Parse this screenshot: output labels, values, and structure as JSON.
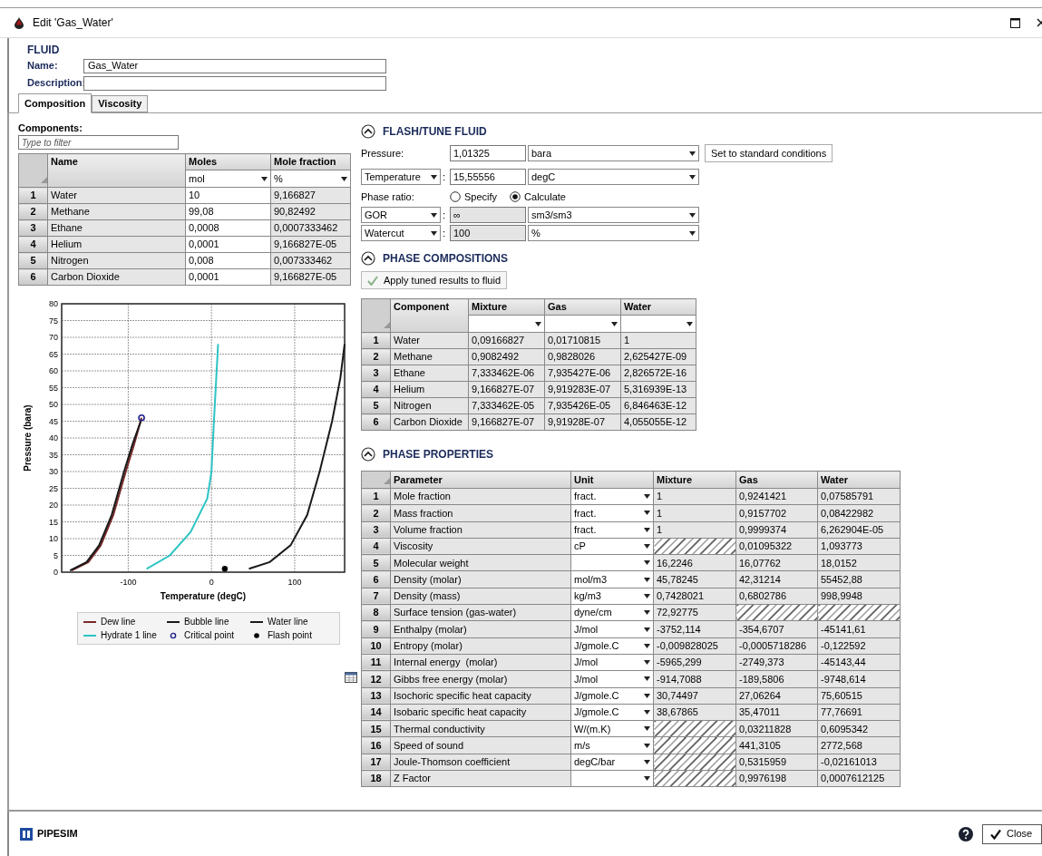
{
  "window": {
    "title": "Edit 'Gas_Water'"
  },
  "fluid": {
    "heading": "FLUID",
    "name_label": "Name:",
    "name_value": "Gas_Water",
    "description_label": "Description:"
  },
  "tabs": [
    {
      "label": "Composition",
      "selected": true
    },
    {
      "label": "Viscosity",
      "selected": false
    }
  ],
  "components": {
    "label": "Components:",
    "filter_placeholder": "Type to filter",
    "columns": [
      {
        "label": "Name"
      },
      {
        "label": "Moles",
        "unit": "mol"
      },
      {
        "label": "Mole fraction",
        "unit": "%"
      }
    ],
    "rows": [
      {
        "index": "1",
        "name": "Water",
        "moles": "10",
        "mole_fraction": "9,166827"
      },
      {
        "index": "2",
        "name": "Methane",
        "moles": "99,08",
        "mole_fraction": "90,82492"
      },
      {
        "index": "3",
        "name": "Ethane",
        "moles": "0,0008",
        "mole_fraction": "0,0007333462"
      },
      {
        "index": "4",
        "name": "Helium",
        "moles": "0,0001",
        "mole_fraction": "9,166827E-05"
      },
      {
        "index": "5",
        "name": "Nitrogen",
        "moles": "0,008",
        "mole_fraction": "0,007333462"
      },
      {
        "index": "6",
        "name": "Carbon Dioxide",
        "moles": "0,0001",
        "mole_fraction": "9,166827E-05"
      }
    ]
  },
  "phase_envelope": {
    "chart_data": {
      "type": "line",
      "xlabel": "Temperature (degC)",
      "ylabel": "Pressure (bara)",
      "xlim": [
        -180,
        160
      ],
      "ylim": [
        0,
        80
      ],
      "xticks": [
        -100,
        0,
        100
      ],
      "yticks": [
        0,
        5,
        10,
        15,
        20,
        25,
        30,
        35,
        40,
        45,
        50,
        55,
        60,
        65,
        70,
        75,
        80
      ],
      "grid": true,
      "series": [
        {
          "name": "Dew line",
          "color": "#7a2a2a",
          "x": [
            -168,
            -148,
            -133,
            -118,
            -103,
            -93,
            -84
          ],
          "values": [
            0.5,
            3,
            8,
            17,
            30,
            38,
            46
          ]
        },
        {
          "name": "Bubble line",
          "color": "#1a1a1a",
          "x": [
            -170,
            -150,
            -135,
            -120,
            -105,
            -95,
            -85
          ],
          "values": [
            0.5,
            3,
            8,
            17,
            30,
            38,
            45
          ]
        },
        {
          "name": "Water line",
          "color": "#1a1a1a",
          "x": [
            45,
            70,
            95,
            115,
            130,
            145,
            155,
            160
          ],
          "values": [
            1,
            3,
            8,
            17,
            30,
            45,
            58,
            68
          ]
        },
        {
          "name": "Hydrate 1 line",
          "color": "#2ec4c4",
          "x": [
            -78,
            -50,
            -25,
            -5,
            0,
            3,
            8
          ],
          "values": [
            1,
            5,
            12,
            22,
            30,
            45,
            68
          ]
        },
        {
          "name": "Critical point",
          "marker": "open_circle",
          "color": "#1e1e8c",
          "x": [
            -84
          ],
          "values": [
            46
          ]
        },
        {
          "name": "Flash point",
          "marker": "filled_circle",
          "color": "#000000",
          "x": [
            16
          ],
          "values": [
            1
          ]
        }
      ]
    }
  },
  "flash": {
    "heading": "FLASH/TUNE FLUID",
    "expanded": true,
    "pressure": {
      "label": "Pressure:",
      "value": "1,01325",
      "unit": "bara",
      "button": "Set to standard conditions"
    },
    "temperature": {
      "selector": "Temperature",
      "separator": ":",
      "value": "15,55556",
      "unit": "degC"
    },
    "phase_ratio": {
      "label": "Phase ratio:",
      "options": [
        {
          "label": "Specify",
          "selected": false
        },
        {
          "label": "Calculate",
          "selected": true
        }
      ]
    },
    "ratios": [
      {
        "selector": "GOR",
        "separator": ":",
        "value": "∞",
        "unit": "sm3/sm3",
        "disabled": true
      },
      {
        "selector": "Watercut",
        "separator": ":",
        "value": "100",
        "unit": "%",
        "disabled": true
      }
    ]
  },
  "phase_compositions": {
    "heading": "PHASE COMPOSITIONS",
    "expanded": true,
    "apply_button": "Apply tuned results to fluid",
    "columns": [
      "Component",
      "Mixture",
      "Gas",
      "Water"
    ],
    "rows": [
      {
        "index": "1",
        "cells": [
          "Water",
          "0,09166827",
          "0,01710815",
          "1"
        ]
      },
      {
        "index": "2",
        "cells": [
          "Methane",
          "0,9082492",
          "0,9828026",
          "2,625427E-09"
        ]
      },
      {
        "index": "3",
        "cells": [
          "Ethane",
          "7,333462E-06",
          "7,935427E-06",
          "2,826572E-16"
        ]
      },
      {
        "index": "4",
        "cells": [
          "Helium",
          "9,166827E-07",
          "9,919283E-07",
          "5,316939E-13"
        ]
      },
      {
        "index": "5",
        "cells": [
          "Nitrogen",
          "7,333462E-05",
          "7,935426E-05",
          "6,846463E-12"
        ]
      },
      {
        "index": "6",
        "cells": [
          "Carbon Dioxide",
          "9,166827E-07",
          "9,91928E-07",
          "4,055055E-12"
        ]
      }
    ]
  },
  "phase_properties": {
    "heading": "PHASE PROPERTIES",
    "expanded": true,
    "columns": [
      "Parameter",
      "Unit",
      "Mixture",
      "Gas",
      "Water"
    ],
    "rows": [
      {
        "index": "1",
        "parameter": "Mole fraction",
        "unit": "fract.",
        "mixture": "1",
        "gas": "0,9241421",
        "water": "0,07585791"
      },
      {
        "index": "2",
        "parameter": "Mass fraction",
        "unit": "fract.",
        "mixture": "1",
        "gas": "0,9157702",
        "water": "0,08422982"
      },
      {
        "index": "3",
        "parameter": "Volume fraction",
        "unit": "fract.",
        "mixture": "1",
        "gas": "0,9999374",
        "water": "6,262904E-05"
      },
      {
        "index": "4",
        "parameter": "Viscosity",
        "unit": "cP",
        "mixture": null,
        "gas": "0,01095322",
        "water": "1,093773"
      },
      {
        "index": "5",
        "parameter": "Molecular weight",
        "unit": null,
        "mixture": "16,2246",
        "gas": "16,07762",
        "water": "18,0152"
      },
      {
        "index": "6",
        "parameter": "Density (molar)",
        "unit": "mol/m3",
        "mixture": "45,78245",
        "gas": "42,31214",
        "water": "55452,88"
      },
      {
        "index": "7",
        "parameter": "Density (mass)",
        "unit": "kg/m3",
        "mixture": "0,7428021",
        "gas": "0,6802786",
        "water": "998,9948"
      },
      {
        "index": "8",
        "parameter": "Surface tension (gas-water)",
        "unit": "dyne/cm",
        "mixture": "72,92775",
        "gas": null,
        "water": null
      },
      {
        "index": "9",
        "parameter": "Enthalpy (molar)",
        "unit": "J/mol",
        "mixture": "-3752,114",
        "gas": "-354,6707",
        "water": "-45141,61"
      },
      {
        "index": "10",
        "parameter": "Entropy (molar)",
        "unit": "J/gmole.C",
        "mixture": "-0,009828025",
        "gas": "-0,0005718286",
        "water": "-0,122592"
      },
      {
        "index": "11",
        "parameter": "Internal energy  (molar)",
        "unit": "J/mol",
        "mixture": "-5965,299",
        "gas": "-2749,373",
        "water": "-45143,44"
      },
      {
        "index": "12",
        "parameter": "Gibbs free energy (molar)",
        "unit": "J/mol",
        "mixture": "-914,7088",
        "gas": "-189,5806",
        "water": "-9748,614"
      },
      {
        "index": "13",
        "parameter": "Isochoric specific heat capacity",
        "unit": "J/gmole.C",
        "mixture": "30,74497",
        "gas": "27,06264",
        "water": "75,60515"
      },
      {
        "index": "14",
        "parameter": "Isobaric specific heat capacity",
        "unit": "J/gmole.C",
        "mixture": "38,67865",
        "gas": "35,47011",
        "water": "77,76691"
      },
      {
        "index": "15",
        "parameter": "Thermal conductivity",
        "unit": "W/(m.K)",
        "mixture": null,
        "gas": "0,03211828",
        "water": "0,6095342"
      },
      {
        "index": "16",
        "parameter": "Speed of sound",
        "unit": "m/s",
        "mixture": null,
        "gas": "441,3105",
        "water": "2772,568"
      },
      {
        "index": "17",
        "parameter": "Joule-Thomson coefficient",
        "unit": "degC/bar",
        "mixture": null,
        "gas": "0,5315959",
        "water": "-0,02161013"
      },
      {
        "index": "18",
        "parameter": "Z Factor",
        "unit": null,
        "mixture": null,
        "gas": "0,9976198",
        "water": "0,0007612125"
      }
    ]
  },
  "footer": {
    "brand": "PIPESIM",
    "close_button": "Close"
  }
}
